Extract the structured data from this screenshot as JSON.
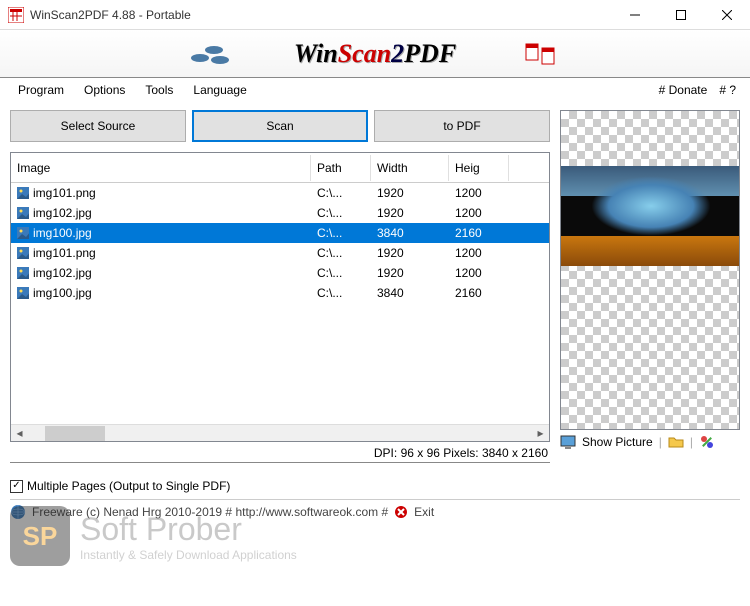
{
  "titlebar": {
    "title": "WinScan2PDF 4.88 - Portable"
  },
  "banner": {
    "win": "Win",
    "scan": "Scan",
    "two": "2",
    "pdf": "PDF"
  },
  "menu": {
    "program": "Program",
    "options": "Options",
    "tools": "Tools",
    "language": "Language",
    "donate": "# Donate",
    "help": "# ?"
  },
  "buttons": {
    "select_source": "Select Source",
    "scan": "Scan",
    "to_pdf": "to PDF"
  },
  "list": {
    "headers": {
      "image": "Image",
      "path": "Path",
      "width": "Width",
      "height": "Heig"
    },
    "rows": [
      {
        "image": "img101.png",
        "path": "C:\\...",
        "width": "1920",
        "height": "1200",
        "selected": false
      },
      {
        "image": "img102.jpg",
        "path": "C:\\...",
        "width": "1920",
        "height": "1200",
        "selected": false
      },
      {
        "image": "img100.jpg",
        "path": "C:\\...",
        "width": "3840",
        "height": "2160",
        "selected": true
      },
      {
        "image": "img101.png",
        "path": "C:\\...",
        "width": "1920",
        "height": "1200",
        "selected": false
      },
      {
        "image": "img102.jpg",
        "path": "C:\\...",
        "width": "1920",
        "height": "1200",
        "selected": false
      },
      {
        "image": "img100.jpg",
        "path": "C:\\...",
        "width": "3840",
        "height": "2160",
        "selected": false
      }
    ]
  },
  "status": {
    "dpi": "DPI: 96 x 96 Pixels: 3840 x 2160"
  },
  "right": {
    "show_picture": "Show Picture"
  },
  "checkbox": {
    "label": "Multiple Pages (Output to Single PDF)",
    "checked": true
  },
  "footer": {
    "text": "Freeware (c) Nenad Hrg 2010-2019 # http://www.softwareok.com # ",
    "exit": "Exit"
  },
  "watermark": {
    "big": "Soft Prober",
    "small": "Instantly & Safely Download Applications",
    "logo": "SP"
  }
}
